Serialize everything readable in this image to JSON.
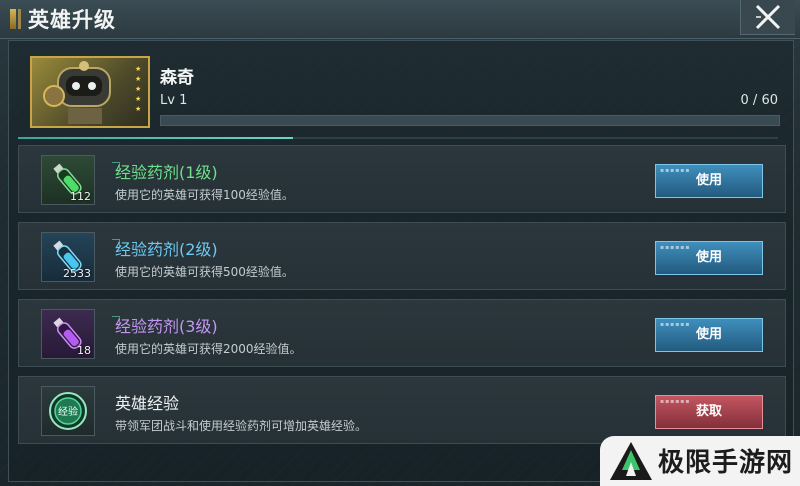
{
  "window": {
    "title": "英雄升级"
  },
  "hero": {
    "name": "森奇",
    "level": "Lv 1",
    "exp_text": "0 / 60",
    "exp_progress": 0,
    "stars": 5
  },
  "items": [
    {
      "name": "经验药剂(1级)",
      "desc": "使用它的英雄可获得100经验值。",
      "count": "112",
      "button": "使用",
      "title_color": "#6fe08a",
      "icon": "green-potion-icon"
    },
    {
      "name": "经验药剂(2级)",
      "desc": "使用它的英雄可获得500经验值。",
      "count": "2533",
      "button": "使用",
      "title_color": "#6ec8f0",
      "icon": "blue-potion-icon"
    },
    {
      "name": "经验药剂(3级)",
      "desc": "使用它的英雄可获得2000经验值。",
      "count": "18",
      "button": "使用",
      "title_color": "#c596f2",
      "icon": "purple-potion-icon"
    },
    {
      "name": "英雄经验",
      "desc": "带领军团战斗和使用经验药剂可增加英雄经验。",
      "count": "",
      "button": "获取",
      "title_color": "#f0f2f2",
      "icon": "hero-exp-badge-icon",
      "icon_text": "经验"
    }
  ],
  "watermark": {
    "text": "极限手游网"
  },
  "colors": {
    "use_button": "#2f77a3",
    "get_button": "#a8404c",
    "accent": "#4fc3e8"
  }
}
